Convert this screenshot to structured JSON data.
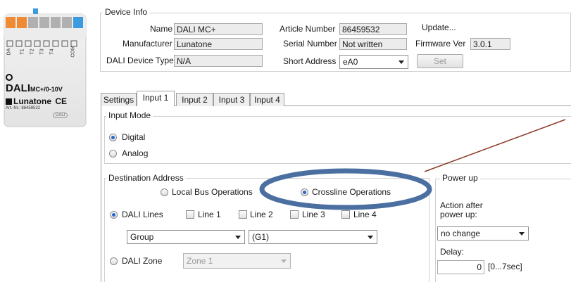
{
  "device": {
    "brand": "DALI",
    "model_suffix": "MC+/0-10V",
    "manufacturer_logo": "Lunatone",
    "article_text": "Art.-Nr.: 86459532",
    "ce_mark": "CE",
    "dali_badge": "DALI",
    "terminal_labels": [
      "DA",
      "T1",
      "T2",
      "T3",
      "T4",
      "COM"
    ]
  },
  "device_info": {
    "group_title": "Device Info",
    "name_label": "Name",
    "name_value": "DALI MC+",
    "article_label": "Article Number",
    "article_value": "86459532",
    "update_label": "Update...",
    "manufacturer_label": "Manufacturer",
    "manufacturer_value": "Lunatone",
    "serial_label": "Serial Number",
    "serial_value": "Not written",
    "firmware_label": "Firmware Ver",
    "firmware_value": "3.0.1",
    "device_type_label": "DALI Device Type",
    "device_type_value": "N/A",
    "short_address_label": "Short Address",
    "short_address_value": "eA0",
    "set_label": "Set"
  },
  "tabs": [
    "Settings",
    "Input 1",
    "Input 2",
    "Input 3",
    "Input 4"
  ],
  "active_tab": "Input 1",
  "input_mode": {
    "title": "Input Mode",
    "options": [
      "Digital",
      "Analog"
    ],
    "selected": "Digital"
  },
  "destination": {
    "title": "Destination Address",
    "local_bus": "Local Bus Operations",
    "crossline": "Crossline Operations",
    "selected": "Crossline Operations",
    "dali_lines_label": "DALI Lines",
    "lines": [
      "Line 1",
      "Line 2",
      "Line 3",
      "Line 4"
    ],
    "group_select": "Group",
    "g_select": "(G1)",
    "dali_zone_label": "DALI Zone",
    "zone_select": "Zone 1"
  },
  "power_up": {
    "title": "Power up",
    "action_label_1": "Action after",
    "action_label_2": "power up:",
    "action_value": "no change",
    "delay_label": "Delay:",
    "delay_value": "0",
    "delay_range": "[0...7sec]"
  },
  "colors": {
    "highlight_ellipse": "#4a6fa0",
    "pointer_line": "#8c3a2a",
    "device_orange": "#f08a35",
    "device_blue": "#3a9be0",
    "radio_selected": "#2a66c8"
  }
}
